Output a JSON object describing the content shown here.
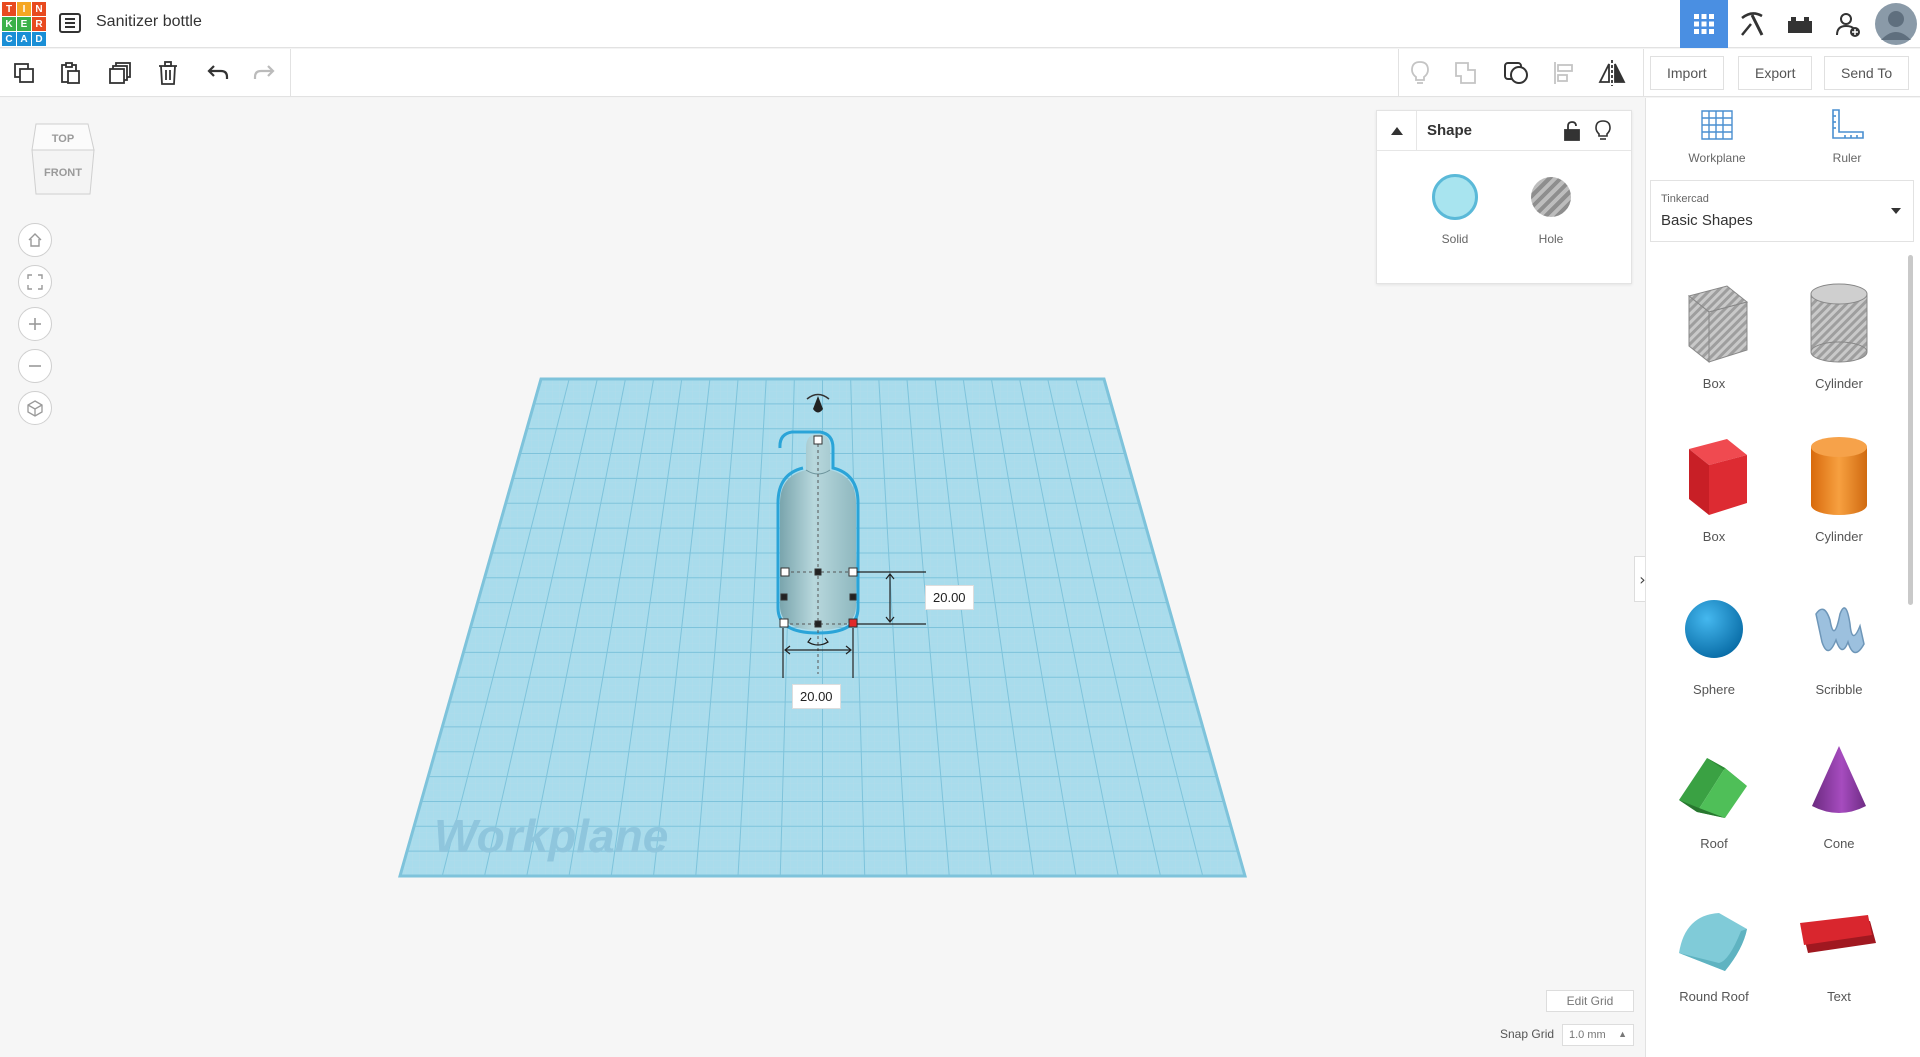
{
  "app": {
    "logo_letters": [
      "T",
      "I",
      "N",
      "K",
      "E",
      "R",
      "C",
      "A",
      "D"
    ],
    "logo_colors": [
      "#e84a1f",
      "#f5a623",
      "#e84a1f",
      "#3bb149",
      "#3bb149",
      "#e84a1f",
      "#1a8fd6",
      "#1a8fd6",
      "#1a8fd6"
    ],
    "title": "Sanitizer bottle"
  },
  "topbar": {
    "icons": [
      "grid-view-icon",
      "pickaxe-icon",
      "bricks-icon",
      "add-user-icon",
      "avatar"
    ],
    "active": "grid-view-icon"
  },
  "toolbar": {
    "left_icons": [
      "copy-icon",
      "paste-icon",
      "duplicate-icon",
      "delete-icon",
      "undo-icon",
      "redo-icon"
    ],
    "right_icons": [
      "bulb-icon",
      "group-icon",
      "ungroup-icon",
      "align-icon",
      "mirror-icon"
    ],
    "import_label": "Import",
    "export_label": "Export",
    "send_label": "Send To"
  },
  "viewcube": {
    "top": "TOP",
    "front": "FRONT"
  },
  "nav_icons": [
    "home-view-icon",
    "fit-view-icon",
    "zoom-in-icon",
    "zoom-out-icon",
    "perspective-icon"
  ],
  "inspector": {
    "title": "Shape",
    "solid_label": "Solid",
    "hole_label": "Hole"
  },
  "workplane": {
    "label": "Workplane",
    "width_value": "20.00",
    "height_value": "20.00"
  },
  "grid_controls": {
    "edit_grid": "Edit Grid",
    "snap_label": "Snap Grid",
    "snap_value": "1.0 mm"
  },
  "sidebar": {
    "workplane_label": "Workplane",
    "ruler_label": "Ruler",
    "library_provider": "Tinkercad",
    "library_name": "Basic Shapes",
    "shapes": [
      {
        "label": "Box",
        "kind": "hole-box"
      },
      {
        "label": "Cylinder",
        "kind": "hole-cylinder"
      },
      {
        "label": "Box",
        "kind": "box",
        "color": "#d8232a"
      },
      {
        "label": "Cylinder",
        "kind": "cylinder",
        "color": "#f08a1c"
      },
      {
        "label": "Sphere",
        "kind": "sphere",
        "color": "#1a8fd0"
      },
      {
        "label": "Scribble",
        "kind": "scribble",
        "color": "#8fb6d6"
      },
      {
        "label": "Roof",
        "kind": "roof",
        "color": "#3aa143"
      },
      {
        "label": "Cone",
        "kind": "cone",
        "color": "#8a3a9c"
      },
      {
        "label": "Round Roof",
        "kind": "round-roof",
        "color": "#7ec9d4"
      },
      {
        "label": "Text",
        "kind": "text",
        "color": "#c8202a"
      }
    ]
  }
}
